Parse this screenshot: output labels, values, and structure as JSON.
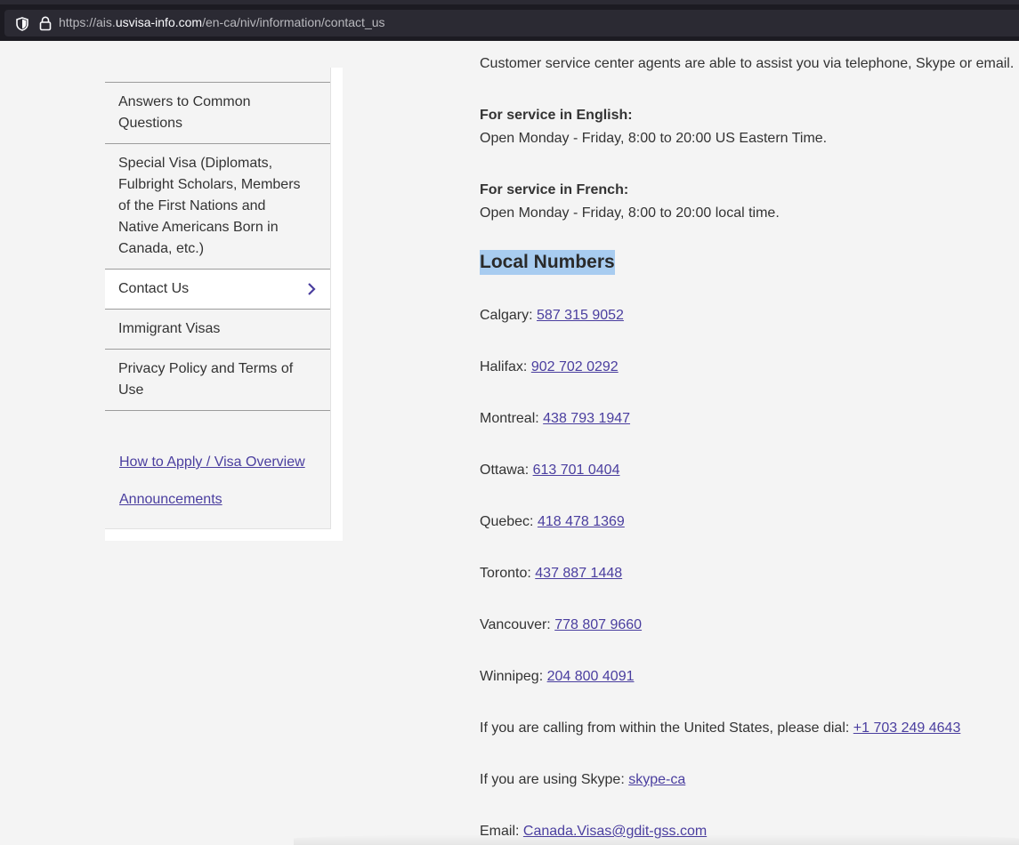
{
  "browser": {
    "url_prefix": "https://ais.",
    "url_domain": "usvisa-info.com",
    "url_path": "/en-ca/niv/information/contact_us"
  },
  "sidebar": {
    "items": [
      {
        "label": "Answers to Common Questions"
      },
      {
        "label": "Special Visa (Diplomats, Fulbright Scholars, Members of the First Nations and Native Americans Born in Canada, etc.)"
      },
      {
        "label": "Contact Us"
      },
      {
        "label": "Immigrant Visas"
      },
      {
        "label": "Privacy Policy and Terms of Use"
      }
    ],
    "links": [
      {
        "label": "How to Apply / Visa Overview"
      },
      {
        "label": "Announcements"
      }
    ]
  },
  "main": {
    "intro": "Customer service center agents are able to assist you via telephone, Skype or email.",
    "english_heading": "For service in English:",
    "english_hours": "Open Monday - Friday, 8:00 to 20:00 US Eastern Time.",
    "french_heading": "For service in French:",
    "french_hours": "Open Monday - Friday, 8:00 to 20:00 local time.",
    "local_numbers_heading": "Local Numbers",
    "numbers": [
      {
        "city": "Calgary:",
        "phone": "587 315 9052"
      },
      {
        "city": "Halifax:",
        "phone": "902 702 0292"
      },
      {
        "city": "Montreal:",
        "phone": "438 793 1947"
      },
      {
        "city": "Ottawa:",
        "phone": "613 701 0404"
      },
      {
        "city": "Quebec:",
        "phone": "418 478 1369"
      },
      {
        "city": "Toronto:",
        "phone": "437 887 1448"
      },
      {
        "city": "Vancouver:",
        "phone": "778 807 9660"
      },
      {
        "city": "Winnipeg:",
        "phone": "204 800 4091"
      }
    ],
    "us_text": "If you are calling from within the United States, please dial:",
    "us_phone": "+1 703 249 4643",
    "skype_text": "If you are using Skype:",
    "skype_link": "skype-ca",
    "email_text": "Email:",
    "email_link": "Canada.Visas@gdit-gss.com"
  },
  "colors": {
    "link": "#4a3e9f",
    "selection": "#a8ccf0",
    "chrome": "#1c1b22"
  }
}
